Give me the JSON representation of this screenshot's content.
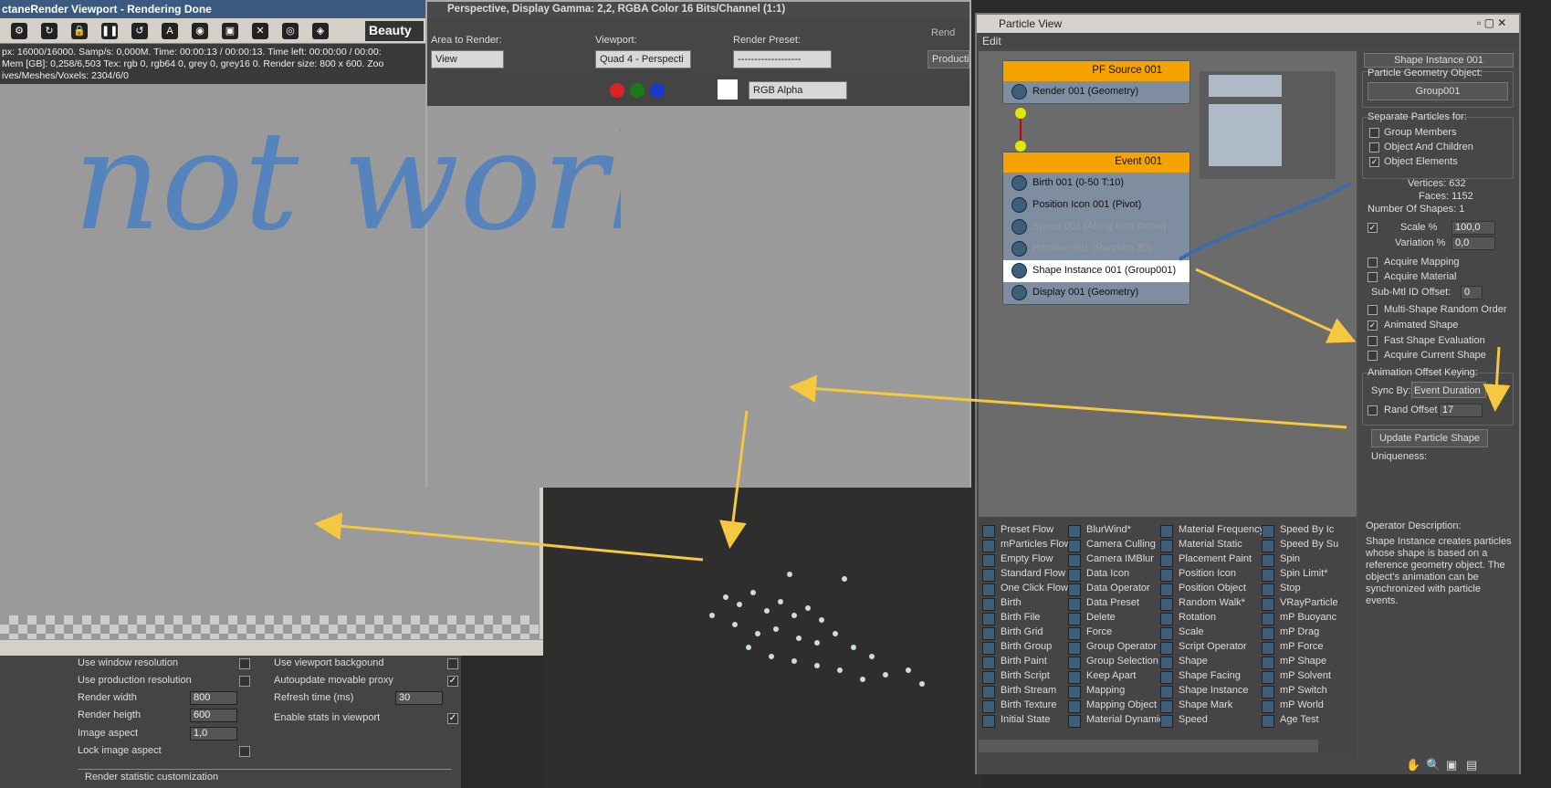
{
  "octane": {
    "title": "ctaneRender Viewport - Rendering Done",
    "beauty": "Beauty",
    "stats": [
      "px: 16000/16000.   Samp/s: 0,000M.   Time: 00:00:13 / 00:00:13.   Time left: 00:00:00 / 00:00:",
      "Mem [GB]: 0,258/6,503   Tex: rgb 0, rgb64 0, grey 0, grey16 0.   Render size: 800 x 600.   Zoo",
      "ives/Meshes/Voxels: 2304/6/0"
    ],
    "toolbar_icons": [
      "settings-icon",
      "refresh-icon",
      "lock-icon",
      "pause-icon",
      "stop-icon",
      "reload-icon",
      "afi-icon",
      "color-icon",
      "display-icon",
      "camera-icon"
    ]
  },
  "bottom_panel": {
    "use_window_resolution": "Use window resolution",
    "use_production_resolution": "Use production resolution",
    "render_width_label": "Render width",
    "render_width": "800",
    "render_height_label": "Render heigth",
    "render_height": "600",
    "image_aspect_label": "Image aspect",
    "image_aspect": "1,0",
    "lock_image_aspect": "Lock image aspect",
    "use_viewport_background": "Use viewport backgound",
    "autoupdate_proxy": "Autoupdate movable proxy",
    "refresh_time_label": "Refresh time (ms)",
    "refresh_time": "30",
    "enable_stats": "Enable stats in viewport",
    "render_statistic": "Render statistic customization"
  },
  "perspective": {
    "title": "Perspective, Display Gamma: 2,2, RGBA Color 16 Bits/Channel (1:1)",
    "area_label": "Area to Render:",
    "area_value": "View",
    "viewport_label": "Viewport:",
    "viewport_value": "Quad 4 - Perspecti",
    "preset_label": "Render Preset:",
    "preset_value": "-------------------",
    "render_btn": "Rend",
    "production": "Production",
    "channel": "RGB Alpha"
  },
  "handwriting": "not work.",
  "particle_view": {
    "title": "Particle View",
    "menu": "Edit",
    "source_node": {
      "header": "PF Source 001",
      "ops": [
        "Render 001 (Geometry)"
      ]
    },
    "event_node": {
      "header": "Event 001",
      "ops": [
        {
          "label": "Birth 001 (0-50 T:10)",
          "state": "on"
        },
        {
          "label": "Position Icon 001 (Pivot)",
          "state": "on"
        },
        {
          "label": "Speed 001 (Along Icon Arrow)",
          "state": "disabled"
        },
        {
          "label": "Rotation 001 (Random 3D)",
          "state": "disabled"
        },
        {
          "label": "Shape Instance 001 (Group001)",
          "state": "selected"
        },
        {
          "label": "Display 001 (Geometry)",
          "state": "on"
        }
      ]
    },
    "panel": {
      "rollout_title": "Shape Instance 001",
      "geom_object_label": "Particle Geometry Object:",
      "geom_object": "Group001",
      "separate_label": "Separate Particles for:",
      "group_members": "Group Members",
      "object_children": "Object And Children",
      "object_elements": "Object Elements",
      "vertices": "Vertices: 632",
      "faces": "Faces: 1152",
      "num_shapes": "Number Of Shapes: 1",
      "scale_label": "Scale %",
      "scale": "100,0",
      "variation_label": "Variation %",
      "variation": "0,0",
      "acquire_mapping": "Acquire Mapping",
      "acquire_material": "Acquire Material",
      "submtl_label": "Sub-Mtl ID Offset:",
      "submtl": "0",
      "multi_shape": "Multi-Shape Random Order",
      "animated_shape": "Animated Shape",
      "fast_shape": "Fast Shape Evaluation",
      "acquire_current": "Acquire Current Shape",
      "anim_offset_label": "Animation Offset Keying:",
      "sync_by_label": "Sync By:",
      "sync_by": "Event Duration",
      "rand_offset_label": "Rand Offset",
      "rand_offset": "17",
      "update_btn": "Update Particle Shape",
      "uniqueness": "Uniqueness:"
    },
    "depot": {
      "col1": [
        "Preset Flow",
        "mParticles Flow",
        "Empty Flow",
        "Standard Flow",
        "One Click Flow",
        "Birth",
        "Birth File",
        "Birth Grid",
        "Birth Group",
        "Birth Paint",
        "Birth Script",
        "Birth Stream",
        "Birth Texture",
        "Initial State"
      ],
      "col2": [
        "BlurWind*",
        "Camera Culling",
        "Camera IMBlur",
        "Data Icon",
        "Data Operator",
        "Data Preset",
        "Delete",
        "Force",
        "Group Operator",
        "Group Selection",
        "Keep Apart",
        "Mapping",
        "Mapping Object",
        "Material Dynamic"
      ],
      "col3": [
        "Material Frequency",
        "Material Static",
        "Placement Paint",
        "Position Icon",
        "Position Object",
        "Random Walk*",
        "Rotation",
        "Scale",
        "Script Operator",
        "Shape",
        "Shape Facing",
        "Shape Instance",
        "Shape Mark",
        "Speed"
      ],
      "col4": [
        "Speed By Ic",
        "Speed By Su",
        "Spin",
        "Spin Limit*",
        "Stop",
        "VRayParticle",
        "mP Buoyanc",
        "mP Drag",
        "mP Force",
        "mP Shape",
        "mP Solvent",
        "mP Switch",
        "mP World",
        "Age Test"
      ]
    },
    "desc_title": "Operator Description:",
    "desc_text": "Shape Instance creates particles whose shape is based on a reference geometry object. The object's animation can be synchronized with particle events."
  },
  "colors": {
    "arrow": "#f5c842",
    "node_header": "#f5a300",
    "handwriting": "#4a7fc1"
  }
}
